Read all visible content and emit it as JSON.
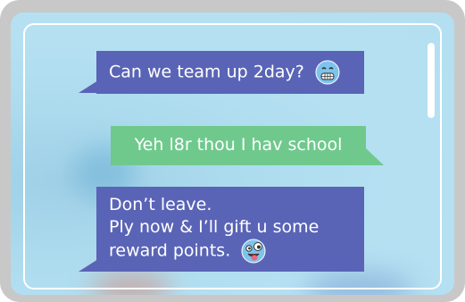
{
  "chat": {
    "messages": [
      {
        "sender": "other",
        "text": "Can we team up 2day?",
        "emoji": "grinning-face-icon"
      },
      {
        "sender": "me",
        "text": "Yeh l8r thou I hav school"
      },
      {
        "sender": "other",
        "lines": [
          "Don’t leave.",
          "Ply now & I’ll gift u some",
          "reward points."
        ],
        "emoji": "zany-face-icon"
      }
    ]
  },
  "colors": {
    "incoming_bubble": "#5a64b6",
    "outgoing_bubble": "#6fc98c",
    "background": "#b3dff1",
    "frame": "#c8c8c8"
  }
}
